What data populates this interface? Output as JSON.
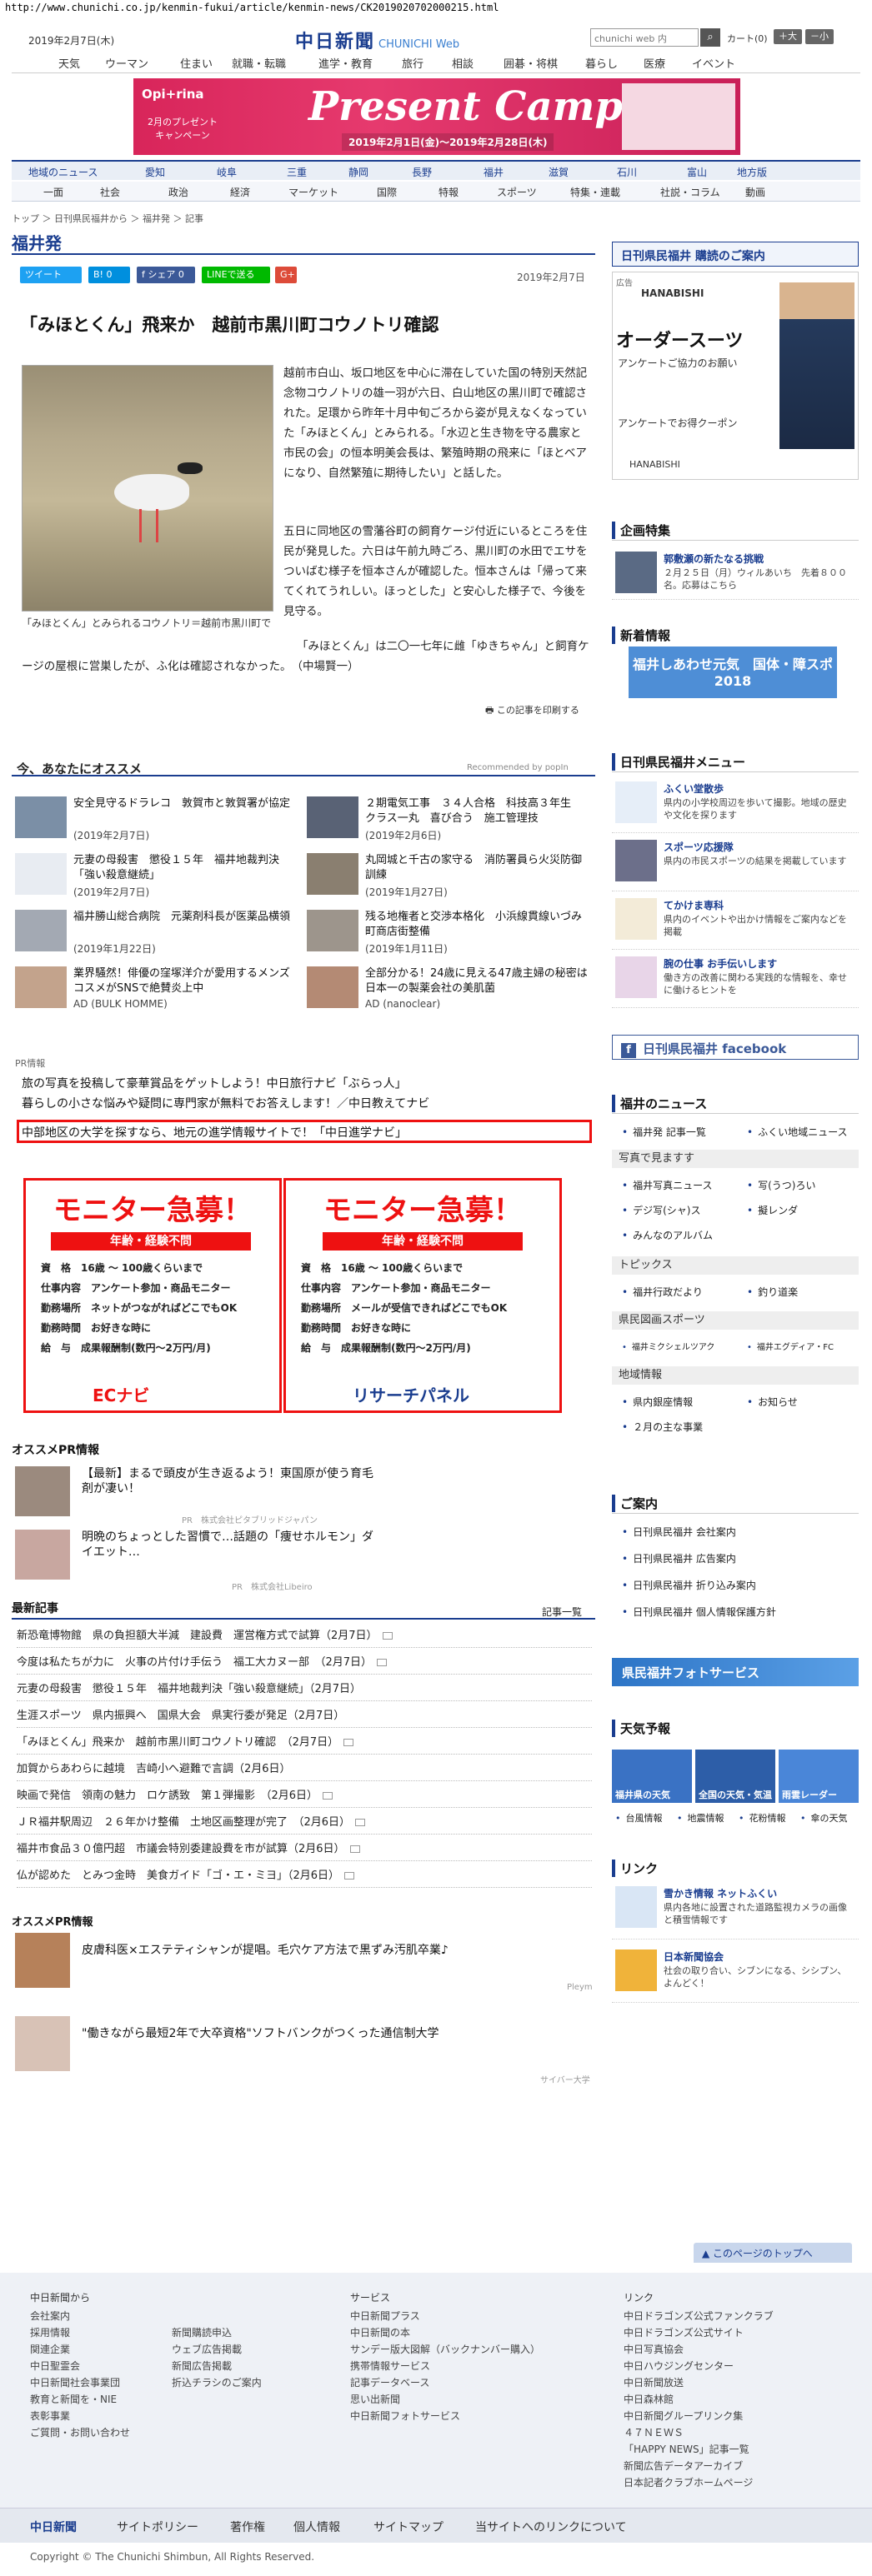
{
  "url": "http://www.chunichi.co.jp/kenmin-fukui/article/kenmin-news/CK2019020702000215.html",
  "header": {
    "date": "2019年2月7日(木)",
    "logo": "中日新聞",
    "logo_sub": "CHUNICHI Web",
    "search_placeholder": "chunichi web 内",
    "cart": "カート(0)",
    "font_large": "＋大",
    "font_small": "－小"
  },
  "global_nav": [
    "天気",
    "ウーマン",
    "住まい",
    "就職・転職",
    "進学・教育",
    "旅行",
    "相談",
    "囲碁・将棋",
    "暮らし",
    "医療",
    "イベント"
  ],
  "banner": {
    "gift": "2月のプレゼント キャンペーン",
    "title": "Present Campaign",
    "period": "2019年2月1日(金)～2019年2月28日(木)",
    "brand": "Opi+rina"
  },
  "section_nav": {
    "row1": [
      "地域のニュース",
      "愛知",
      "岐阜",
      "三重",
      "静岡",
      "長野",
      "福井",
      "滋賀",
      "石川",
      "富山",
      "地方版"
    ],
    "row2": [
      "一面",
      "社会",
      "政治",
      "経済",
      "マーケット",
      "国際",
      "特報",
      "スポーツ",
      "特集・連載",
      "社説・コラム",
      "動画"
    ]
  },
  "breadcrumb": "トップ ＞ 日刊県民福井から ＞ 福井発 ＞ 記事",
  "section_title": "福井発",
  "share": [
    "ツイート",
    "B! 0",
    "f シェア 0",
    "LINEで送る",
    "G+"
  ],
  "article": {
    "date": "2019年2月7日",
    "title": "「みほとくん」飛来か　越前市黒川町コウノトリ確認",
    "caption": "「みほとくん」とみられるコウノトリ＝越前市黒川町で",
    "para1": "越前市白山、坂口地区を中心に滞在していた国の特別天然記念物コウノトリの雄一羽が六日、白山地区の黒川町で確認された。足環から昨年十月中旬ごろから姿が見えなくなっていた「みほとくん」とみられる。「水辺と生き物を守る農家と市民の会」の恒本明美会長は、繁殖時期の飛来に「ほとべアになり、自然繁殖に期待したい」と話した。",
    "para2": "五日に同地区の雪藩谷町の飼育ケージ付近にいるところを住民が発見した。六日は午前九時ごろ、黒川町の水田でエサをついばむ様子を恒本さんが確認した。恒本さんは「帰って来てくれてうれしい。ほっとした」と安心した様子で、今後を見守る。",
    "para3": "「みほとくん」は二〇一七年に雌「ゆきちゃん」と飼育ケージの屋根に営巣したが、ふ化は確認されなかった。　（中場賢一）",
    "print": "この記事を印刷する"
  },
  "recommend": {
    "title": "今、あなたにオススメ",
    "by": "Recommended by popIn",
    "items": [
      {
        "title": "安全見守るドラレコ　敦賀市と敦賀署が協定",
        "date": "(2019年2月7日)"
      },
      {
        "title": "２期電気工事　３４人合格　科技高３年生　クラス一丸　喜び合う　施工管理技",
        "date": "(2019年2月6日)"
      },
      {
        "title": "元妻の母殺害　懲役１５年　福井地裁判決「強い殺意継続」",
        "date": "(2019年2月7日)"
      },
      {
        "title": "丸岡城と千古の家守る　消防署員ら火災防御訓練",
        "date": "(2019年1月27日)"
      },
      {
        "title": "福井勝山総合病院　元薬剤科長が医薬品横領",
        "date": "(2019年1月22日)"
      },
      {
        "title": "残る地権者と交渉本格化　小浜線貫線いづみ町商店街整備",
        "date": "(2019年1月11日)"
      },
      {
        "title": "業界騒然！俳優の窪塚洋介が愛用するメンズコスメがSNSで絶賛炎上中",
        "date": "AD (BULK HOMME)"
      },
      {
        "title": "全部分かる！24歳に見える47歳主婦の秘密は日本一の製薬会社の美肌菌",
        "date": "AD (nanoclear)"
      }
    ]
  },
  "pr": {
    "label": "PR情報",
    "links": [
      "旅の写真を投稿して豪華賞品をゲットしよう！中日旅行ナビ「ぶらっ人」",
      "暮らしの小さな悩みや疑問に専門家が無料でお答えします！／中日教えてナビ",
      "中部地区の大学を探すなら、地元の進学情報サイトで！「中日進学ナビ」"
    ]
  },
  "monitor_ads": [
    {
      "head": "モニター急募！",
      "sub": "年齢・経験不問",
      "r1": "資　格　16歳 ～ 100歳くらいまで",
      "r2": "仕事内容　アンケート参加・商品モニター",
      "r3": "勤務場所　ネットがつながればどこでもOK",
      "r4": "勤務時間　お好きな時に",
      "r5": "給　与　成果報酬制(数円～2万円/月)",
      "brand": "ECナビ"
    },
    {
      "head": "モニター急募！",
      "sub": "年齢・経験不問",
      "r1": "資　格　16歳 ～ 100歳くらいまで",
      "r2": "仕事内容　アンケート参加・商品モニター",
      "r3": "勤務場所　メールが受信できればどこでもOK",
      "r4": "勤務時間　お好きな時に",
      "r5": "給　与　成果報酬制(数円～2万円/月)",
      "brand": "リサーチパネル"
    }
  ],
  "osusume_pr": {
    "title": "オススメPR情報",
    "items": [
      {
        "title": "【最新】まるで頭皮が生き返るよう！東国原が使う育毛剤が凄い！",
        "src": "PR　株式会社ピタブリッドジャパン"
      },
      {
        "title": "明晩のちょっとした習慣で…話題の「痩せホルモン」ダイエット…",
        "src": "PR　株式会社Libeiro"
      }
    ]
  },
  "latest": {
    "title": "最新記事",
    "more": "記事一覧",
    "items": [
      "新恐竜博物館　県の負担額大半減　建設費　運営権方式で試算（2月7日）",
      "今度は私たちが力に　火事の片付け手伝う　福工大カヌー部　（2月7日）",
      "元妻の母殺害　懲役１５年　福井地裁判決「強い殺意継続」（2月7日）",
      "生涯スポーツ　県内振興へ　国県大会　県実行委が発足（2月7日）",
      "「みほとくん」飛来か　越前市黒川町コウノトリ確認　（2月7日）",
      "加賀からあわらに越境　吉崎小へ避難で言調（2月6日）",
      "映画で発信　領南の魅力　ロケ誘致　第１弾撮影　（2月6日）",
      "ＪＲ福井駅周辺　２６年かけ整備　土地区画整理が完了　（2月6日）",
      "福井市食品３０億円超　市議会特別委建設費を市が試算（2月6日）",
      "仏が認めた　とみつ金時　美食ガイド「ゴ・エ・ミヨ」（2月6日）"
    ]
  },
  "osusume_pr2": {
    "title": "オススメPR情報",
    "items": [
      {
        "title": "皮膚科医×エステティシャンが提唱。毛穴ケア方法で黒ずみ汚肌卒業♪",
        "src": "Pleym"
      },
      {
        "title": "\"働きながら最短2年で大卒資格\"ソフトバンクがつくった通信制大学",
        "src": "サイバー大学"
      }
    ]
  },
  "sidebar": {
    "subscribe": "日刊県民福井 購読のご案内",
    "ad_brand": "HANABISHI",
    "ad_title": "オーダースーツ",
    "ad_sub": "アンケートご協力のお願い",
    "ad_caption": "アンケートでお得クーポン",
    "ad_label": "広告",
    "kikaku_title": "企画特集",
    "kikaku_item_title": "郭敷瀬の新たなる挑戦",
    "kikaku_item_desc": "２月２５日（月）ウィルあいち　先着８００名。応募はこちら",
    "shinchaku_title": "新着情報",
    "shinchaku_banner": "福井しあわせ元気　国体・障スポ 2018",
    "menu_title": "日刊県民福井メニュー",
    "menu": [
      {
        "title": "ふくい堂散歩",
        "desc": "県内の小学校周辺を歩いて撮影。地域の歴史や文化を探ります"
      },
      {
        "title": "スポーツ応援隊",
        "desc": "県内の市民スポーツの結果を掲載しています"
      },
      {
        "title": "てかけま専科",
        "desc": "県内のイベントや出かけ情報をご案内などを掲載"
      },
      {
        "title": "腕の仕事 お手伝いします",
        "desc": "働き方の改善に関わる実践的な情報を、幸せに働けるヒントを"
      }
    ],
    "facebook": "日刊県民福井 facebook",
    "news_title": "福井のニュース",
    "news_links": [
      "福井発 記事一覧",
      "ふくい地域ニュース"
    ],
    "photo_head": "写真で見ますす",
    "photo_links": [
      "福井写真ニュース",
      "写(うつ)ろい",
      "デジ写(シャ)ス",
      "擬レンダ",
      "みんなのアルバム"
    ],
    "topics_head": "トピックス",
    "topics_links": [
      "福井行政だより",
      "釣り道楽"
    ],
    "sports_head": "県民図画スポーツ",
    "sports_links": [
      "福井ミクシェルツアク",
      "福井エグディア・FC"
    ],
    "region_head": "地域情報",
    "region_links": [
      "県内銀座情報",
      "お知らせ",
      "２月の主な事業"
    ],
    "guide_title": "ご案内",
    "guide_links": [
      "日刊県民福井 会社案内",
      "日刊県民福井 広告案内",
      "日刊県民福井 折り込み案内",
      "日刊県民福井 個人情報保護方針"
    ],
    "photo_service": "県民福井フォトサービス",
    "tenki_title": "天気予報",
    "tenki_cells": [
      "福井県の天気",
      "全国の天気・気温",
      "雨雲レーダー"
    ],
    "tenki_links": [
      "台風情報",
      "地震情報",
      "花粉情報",
      "傘の天気"
    ],
    "link_title": "リンク",
    "link_items": [
      {
        "title": "雪かき情報 ネットふくい",
        "desc": "県内各地に設置された道路監視カメラの画像と積雪情報です"
      },
      {
        "title": "日本新聞協会",
        "desc": "社会の取り合い、シブンになる、シシプン、よんどく！"
      }
    ]
  },
  "pagetop": "このページのトップへ",
  "footer": {
    "col1_head": "中日新聞から",
    "col1": [
      "会社案内",
      "採用情報",
      "関連企業",
      "中日聖霊会",
      "中日新聞社会事業団",
      "教育と新聞を・NIE",
      "表彰事業",
      "ご質問・お問い合わせ"
    ],
    "col2": [
      "新聞購読申込",
      "ウェブ広告掲載",
      "新聞広告掲載",
      "折込チラシのご案内"
    ],
    "col3_head": "サービス",
    "col3": [
      "中日新聞プラス",
      "中日新聞の本",
      "サンデー版大図解（バックナンバー購入）",
      "携帯情報サービス",
      "記事データベース",
      "思い出新聞",
      "中日新聞フォトサービス"
    ],
    "col4_head": "リンク",
    "col4": [
      "中日ドラゴンズ公式ファンクラブ",
      "中日ドラゴンズ公式サイト",
      "中日写真協会",
      "中日ハウジングセンター",
      "中日新聞放送",
      "中日森林館",
      "中日新聞グループリンク集",
      "４７ＮＥＷＳ",
      "「HAPPY NEWS」記事一覧",
      "新聞広告データアーカイブ",
      "日本記者クラブホームページ"
    ],
    "bar": [
      "中日新聞",
      "サイトポリシー",
      "著作権",
      "個人情報",
      "サイトマップ",
      "当サイトへのリンクについて"
    ],
    "copyright": "Copyright © The Chunichi Shimbun, All Rights Reserved."
  },
  "colors": {
    "brand": "#1a3d8f",
    "accent_red": "#ee1111"
  }
}
